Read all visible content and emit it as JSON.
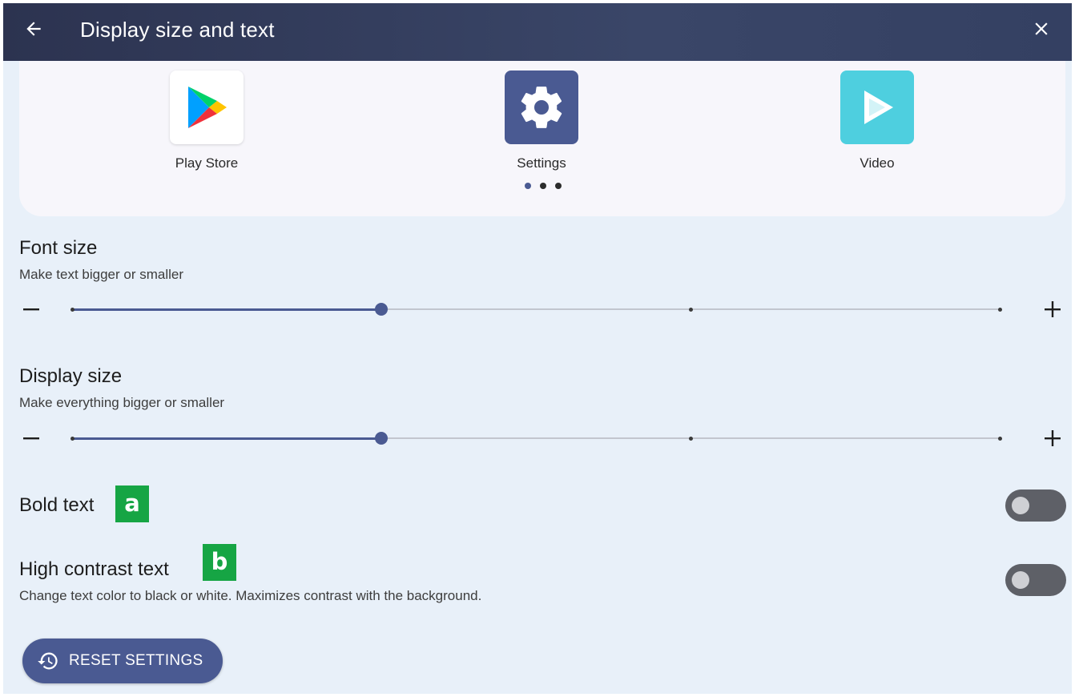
{
  "appbar": {
    "title": "Display size and text",
    "back_icon": "arrow-left-icon",
    "close_icon": "close-icon"
  },
  "preview": {
    "apps": [
      {
        "label": "Play Store",
        "icon": "play-store-icon"
      },
      {
        "label": "Settings",
        "icon": "gear-icon"
      },
      {
        "label": "Video",
        "icon": "play-icon"
      }
    ],
    "page_dots": 3,
    "active_dot": 1
  },
  "font_size": {
    "title": "Font size",
    "subtitle": "Make text bigger or smaller",
    "steps": 4,
    "value_step": 2
  },
  "display_size": {
    "title": "Display size",
    "subtitle": "Make everything bigger or smaller",
    "steps": 4,
    "value_step": 2
  },
  "bold_text": {
    "label": "Bold text",
    "enabled": false,
    "badge": "a"
  },
  "high_contrast": {
    "label": "High contrast text",
    "description": "Change text color to black or white. Maximizes contrast with the background.",
    "enabled": false,
    "badge": "b"
  },
  "reset": {
    "label": "RESET SETTINGS",
    "icon": "history-icon"
  },
  "colors": {
    "appbar": "#2f3856",
    "accent": "#4a5a92",
    "background": "#e8f0f9",
    "badge": "#16a544",
    "toggle_off": "#5e6067"
  }
}
